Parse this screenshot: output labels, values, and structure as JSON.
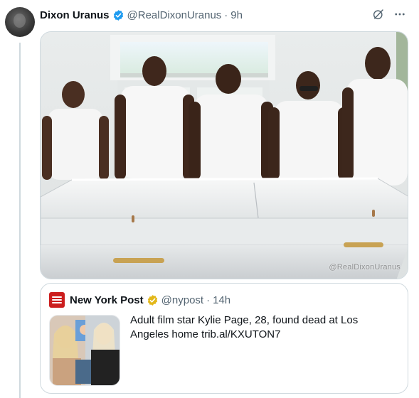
{
  "tweet": {
    "author_name": "Dixon Uranus",
    "author_handle": "@RealDixonUranus",
    "separator": "·",
    "time": "9h",
    "media_watermark": "@RealDixonUranus"
  },
  "quoted_tweet": {
    "author_name": "New York Post",
    "author_handle": "@nypost",
    "separator": "·",
    "time": "14h",
    "text": "Adult film star Kylie Page, 28, found dead at Los Angeles home trib.al/KXUTON7"
  },
  "icons": {
    "verified": "verified-badge-icon",
    "verified_org": "gold-verified-badge-icon",
    "grok": "grok-icon",
    "more": "more-options-icon"
  },
  "colors": {
    "verified_blue": "#1d9bf0",
    "verified_gold": "#e2b719",
    "nyp_red": "#cc1e1e",
    "secondary_text": "#536471",
    "border": "#cfd9de"
  }
}
